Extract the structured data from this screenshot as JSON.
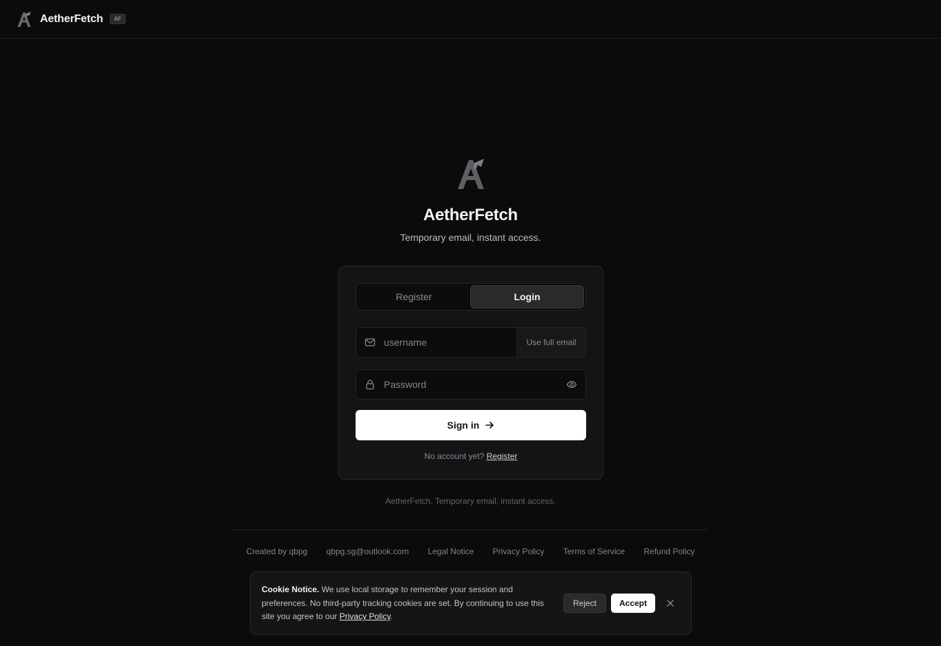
{
  "header": {
    "brand": "AetherFetch",
    "badge": "AF"
  },
  "hero": {
    "title": "AetherFetch",
    "subtitle": "Temporary email, instant access."
  },
  "auth": {
    "tabs": [
      {
        "label": "Register",
        "active": false
      },
      {
        "label": "Login",
        "active": true
      }
    ],
    "username_placeholder": "username",
    "username_suffix": "Use full email",
    "password_placeholder": "Password",
    "submit_label": "Sign in",
    "no_account_text": "No account yet?",
    "no_account_link": "Register"
  },
  "tagline": "AetherFetch. Temporary email, instant access.",
  "footer": {
    "links": [
      "Created by qbpg",
      "qbpg.sg@outlook.com",
      "Legal Notice",
      "Privacy Policy",
      "Terms of Service",
      "Refund Policy"
    ],
    "separator": "·"
  },
  "cookie": {
    "title": "Cookie Notice.",
    "body": " We use local storage to remember your session and preferences. No third-party tracking cookies are set. By continuing to use this site you agree to our ",
    "link": "Privacy Policy",
    "end": ".",
    "reject_label": "Reject",
    "accept_label": "Accept"
  },
  "colors": {
    "background": "#0b0b0c",
    "card": "#141416",
    "primary_button": "#ffffff"
  }
}
